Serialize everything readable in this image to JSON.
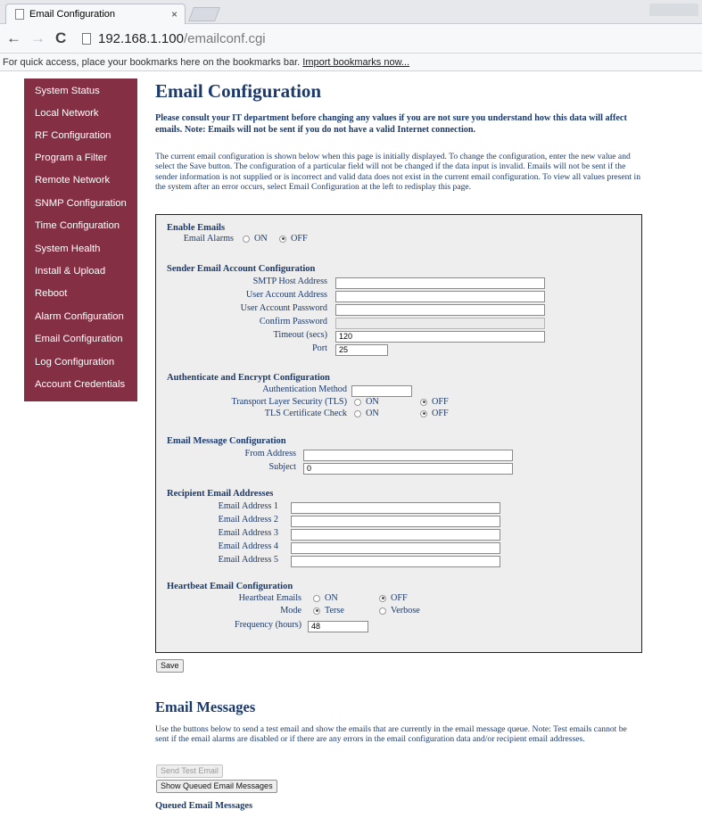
{
  "browser": {
    "tab_title": "Email Configuration",
    "close_glyph": "×",
    "url_host": "192.168.1.100",
    "url_path": "/emailconf.cgi",
    "bookmarks_text": "For quick access, place your bookmarks here on the bookmarks bar.",
    "bookmarks_link": "Import bookmarks now..."
  },
  "sidebar": {
    "items": [
      "System Status",
      "Local Network",
      "RF Configuration",
      "Program a Filter",
      "Remote Network",
      "SNMP Configuration",
      "Time Configuration",
      "System Health",
      "Install & Upload",
      "Reboot",
      "Alarm Configuration",
      "Email Configuration",
      "Log Configuration",
      "Account Credentials"
    ]
  },
  "page": {
    "title": "Email Configuration",
    "warning": "Please consult your IT department before changing any values if you are not sure you understand how this data will affect emails.   Note: Emails will not be sent if you do not have a valid Internet connection.",
    "intro": "The current email configuration is shown below when this page is initially displayed. To change the configuration, enter the new value and select the Save button. The configuration of a particular field will not be changed if the data input is invalid. Emails will not be sent if the sender information is not supplied or is incorrect and valid data does not exist in the current email configuration. To view all values present in the system after an error occurs, select Email Configuration at the left to redisplay this page."
  },
  "form": {
    "enable": {
      "heading": "Enable Emails",
      "alarms_label": "Email Alarms",
      "on": "ON",
      "off": "OFF",
      "selected": "OFF"
    },
    "sender": {
      "heading": "Sender Email Account Configuration",
      "smtp_label": "SMTP Host Address",
      "smtp_value": "",
      "user_label": "User Account Address",
      "user_value": "",
      "password_label": "User Account Password",
      "confirm_label": "Confirm Password",
      "timeout_label": "Timeout (secs)",
      "timeout_value": "120",
      "port_label": "Port",
      "port_value": "25"
    },
    "auth": {
      "heading": "Authenticate and Encrypt Configuration",
      "method_label": "Authentication Method",
      "method_value": "",
      "tls_label": "Transport Layer Security (TLS)",
      "cert_label": "TLS Certificate Check",
      "on": "ON",
      "off": "OFF",
      "tls_selected": "OFF",
      "cert_selected": "OFF"
    },
    "message": {
      "heading": "Email Message Configuration",
      "from_label": "From Address",
      "from_value": "",
      "subject_label": "Subject",
      "subject_value": "0"
    },
    "recipients": {
      "heading": "Recipient Email Addresses",
      "labels": [
        "Email Address 1",
        "Email Address 2",
        "Email Address 3",
        "Email Address 4",
        "Email Address 5"
      ]
    },
    "heartbeat": {
      "heading": "Heartbeat Email Configuration",
      "emails_label": "Heartbeat Emails",
      "on": "ON",
      "off": "OFF",
      "emails_selected": "OFF",
      "mode_label": "Mode",
      "terse": "Terse",
      "verbose": "Verbose",
      "mode_selected": "Terse",
      "frequency_label": "Frequency (hours)",
      "frequency_value": "48"
    },
    "save_label": "Save"
  },
  "messages": {
    "title": "Email Messages",
    "intro": "Use the buttons below to send a test email and show the emails that are currently in the email message queue. Note: Test emails cannot be sent if the email alarms are disabled or if there are any errors in the email configuration data and/or recipient email addresses.",
    "send_test_label": "Send Test Email",
    "show_queued_label": "Show Queued Email Messages",
    "queued_heading": "Queued Email Messages"
  }
}
